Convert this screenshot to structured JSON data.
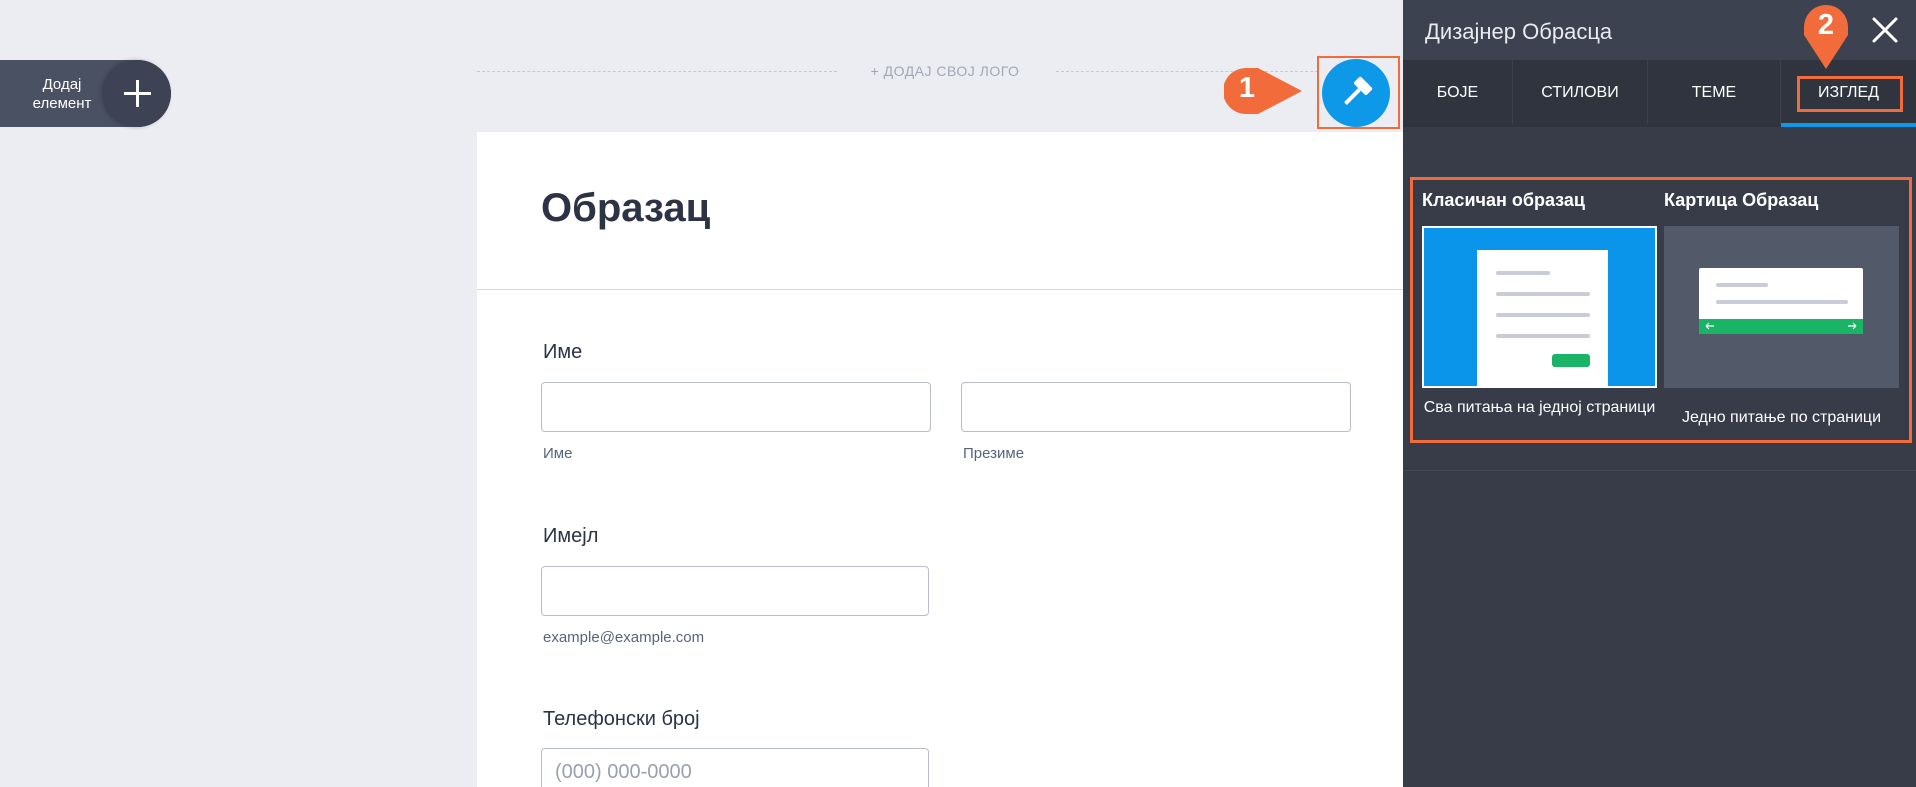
{
  "add_element": {
    "label": "Додај елемент"
  },
  "logo": {
    "text": "+ ДОДАЈ СВОЈ ЛОГО"
  },
  "callouts": {
    "one": "1",
    "two": "2"
  },
  "form": {
    "title": "Образац",
    "name": {
      "label": "Име",
      "first_sub": "Име",
      "last_sub": "Презиме"
    },
    "email": {
      "label": "Имејл",
      "sub": "example@example.com"
    },
    "phone": {
      "label": "Телефонски број",
      "placeholder": "(000) 000-0000"
    }
  },
  "panel": {
    "title": "Дизајнер Обрасца",
    "tabs": [
      "БОЈЕ",
      "СТИЛОВИ",
      "ТЕМЕ",
      "ИЗГЛЕД"
    ],
    "active_tab": "ИЗГЛЕД",
    "layouts": [
      {
        "title": "Класичан образац",
        "caption": "Сва питања на једној страници"
      },
      {
        "title": "Картица Образац",
        "caption": "Једно питање по страници"
      }
    ]
  },
  "colors": {
    "accent_blue": "#0e98e8",
    "annotation_orange": "#f26b3a",
    "panel_bg": "#373c48",
    "canvas_bg": "#ecedf3",
    "card_green": "#19b466"
  },
  "icons": [
    "plus-icon",
    "paint-roller-icon",
    "close-icon",
    "arrow-left-icon",
    "arrow-right-icon"
  ]
}
